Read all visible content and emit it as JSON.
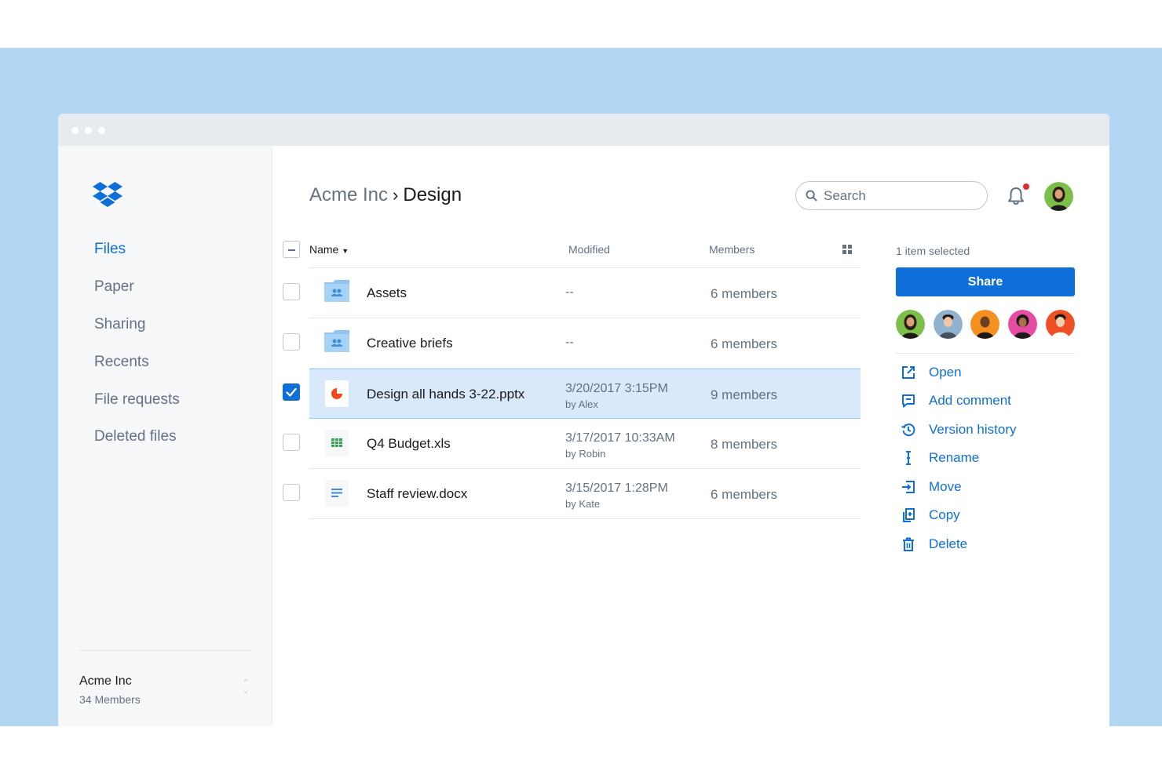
{
  "sidebar": {
    "nav": [
      {
        "label": "Files",
        "active": true
      },
      {
        "label": "Paper",
        "active": false
      },
      {
        "label": "Sharing",
        "active": false
      },
      {
        "label": "Recents",
        "active": false
      },
      {
        "label": "File requests",
        "active": false
      },
      {
        "label": "Deleted files",
        "active": false
      }
    ],
    "team": {
      "name": "Acme Inc",
      "members": "34 Members"
    }
  },
  "header": {
    "breadcrumb_parent": "Acme Inc",
    "breadcrumb_current": "Design",
    "search_placeholder": "Search"
  },
  "table": {
    "columns": {
      "name": "Name",
      "modified": "Modified",
      "members": "Members"
    },
    "rows": [
      {
        "name": "Assets",
        "modified": "--",
        "by": "",
        "members": "6 members",
        "type": "shared-folder",
        "selected": false
      },
      {
        "name": "Creative briefs",
        "modified": "--",
        "by": "",
        "members": "6 members",
        "type": "shared-folder",
        "selected": false
      },
      {
        "name": "Design all hands 3-22.pptx",
        "modified": "3/20/2017 3:15PM",
        "by": "by Alex",
        "members": "9 members",
        "type": "presentation",
        "selected": true
      },
      {
        "name": "Q4 Budget.xls",
        "modified": "3/17/2017 10:33AM",
        "by": "by Robin",
        "members": "8 members",
        "type": "spreadsheet",
        "selected": false
      },
      {
        "name": "Staff review.docx",
        "modified": "3/15/2017 1:28PM",
        "by": "by Kate",
        "members": "6 members",
        "type": "document",
        "selected": false
      }
    ]
  },
  "panel": {
    "selection": "1 item selected",
    "share_label": "Share",
    "actions": [
      {
        "label": "Open",
        "icon": "open-external-icon"
      },
      {
        "label": "Add comment",
        "icon": "comment-icon"
      },
      {
        "label": "Version history",
        "icon": "history-icon"
      },
      {
        "label": "Rename",
        "icon": "rename-cursor-icon"
      },
      {
        "label": "Move",
        "icon": "move-icon"
      },
      {
        "label": "Copy",
        "icon": "copy-icon"
      },
      {
        "label": "Delete",
        "icon": "trash-icon"
      }
    ]
  },
  "colors": {
    "accent": "#0f6fd9",
    "background_band": "#b3d7f2",
    "selected_row": "#d8e9fb",
    "notification": "#e02d2d"
  }
}
